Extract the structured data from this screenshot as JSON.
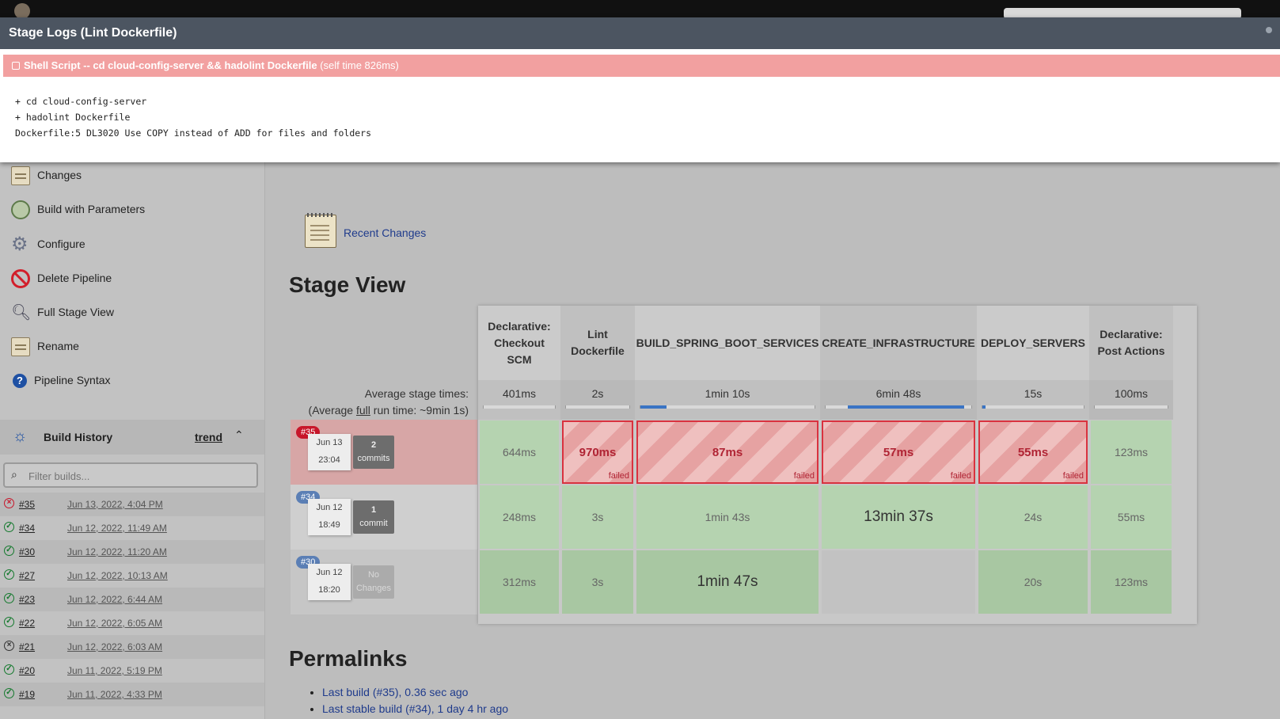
{
  "stage_logs": {
    "title": "Stage Logs (Lint Dockerfile)",
    "step_title": "Shell Script -- cd cloud-config-server && hadolint Dockerfile",
    "step_time": "(self time 826ms)",
    "log_lines": [
      "+ cd cloud-config-server",
      "+ hadolint Dockerfile",
      "Dockerfile:5 DL3020 Use COPY instead of ADD for files and folders"
    ]
  },
  "sidebar": {
    "items": [
      {
        "label": "Changes",
        "icon": "notepad-icon"
      },
      {
        "label": "Build with Parameters",
        "icon": "clock-icon"
      },
      {
        "label": "Configure",
        "icon": "gear-icon"
      },
      {
        "label": "Delete Pipeline",
        "icon": "no-entry-icon"
      },
      {
        "label": "Full Stage View",
        "icon": "magnifier-icon"
      },
      {
        "label": "Rename",
        "icon": "notepad-icon"
      },
      {
        "label": "Pipeline Syntax",
        "icon": "help-icon"
      }
    ]
  },
  "build_history": {
    "title": "Build History",
    "trend_label": "trend",
    "filter_placeholder": "Filter builds...",
    "builds": [
      {
        "num": "#35",
        "date": "Jun 13, 2022, 4:04 PM",
        "status": "failed"
      },
      {
        "num": "#34",
        "date": "Jun 12, 2022, 11:49 AM",
        "status": "success"
      },
      {
        "num": "#30",
        "date": "Jun 12, 2022, 11:20 AM",
        "status": "success"
      },
      {
        "num": "#27",
        "date": "Jun 12, 2022, 10:13 AM",
        "status": "success"
      },
      {
        "num": "#23",
        "date": "Jun 12, 2022, 6:44 AM",
        "status": "success"
      },
      {
        "num": "#22",
        "date": "Jun 12, 2022, 6:05 AM",
        "status": "success"
      },
      {
        "num": "#21",
        "date": "Jun 12, 2022, 6:03 AM",
        "status": "aborted"
      },
      {
        "num": "#20",
        "date": "Jun 11, 2022, 5:19 PM",
        "status": "success"
      },
      {
        "num": "#19",
        "date": "Jun 11, 2022, 4:33 PM",
        "status": "success"
      }
    ]
  },
  "main": {
    "recent_changes": "Recent Changes",
    "stage_view_title": "Stage View",
    "average_stage_times": "Average stage times:",
    "average_full_prefix": "(Average ",
    "average_full_link": "full",
    "average_full_suffix": " run time: ~9min 1s)",
    "permalinks_title": "Permalinks",
    "permalinks": [
      "Last build (#35), 0.36 sec ago",
      "Last stable build (#34), 1 day 4 hr ago"
    ]
  },
  "stage_view": {
    "stages": [
      {
        "name": "Declarative: Checkout SCM",
        "avg": "401ms",
        "avg_fraction": 0.0
      },
      {
        "name": "Lint Dockerfile",
        "avg": "2s",
        "avg_fraction": 0.0
      },
      {
        "name": "BUILD_SPRING_BOOT_SERVICES",
        "avg": "1min 10s",
        "avg_fraction": 0.15
      },
      {
        "name": "CREATE_INFRASTRUCTURE",
        "avg": "6min 48s",
        "avg_fraction": 0.8
      },
      {
        "name": "DEPLOY_SERVERS",
        "avg": "15s",
        "avg_fraction": 0.03
      },
      {
        "name": "Declarative: Post Actions",
        "avg": "100ms",
        "avg_fraction": 0.0
      }
    ],
    "runs": [
      {
        "badge": "#35",
        "date": "Jun 13",
        "time": "23:04",
        "changes_count": "2",
        "changes_label": "commits",
        "status": "failed",
        "cells": [
          {
            "value": "644ms",
            "status": "success"
          },
          {
            "value": "970ms",
            "status": "failed",
            "tag": "failed"
          },
          {
            "value": "87ms",
            "status": "failed",
            "tag": "failed"
          },
          {
            "value": "57ms",
            "status": "failed",
            "tag": "failed"
          },
          {
            "value": "55ms",
            "status": "failed",
            "tag": "failed"
          },
          {
            "value": "123ms",
            "status": "success"
          }
        ]
      },
      {
        "badge": "#34",
        "date": "Jun 12",
        "time": "18:49",
        "changes_count": "1",
        "changes_label": "commit",
        "status": "success",
        "cells": [
          {
            "value": "248ms",
            "status": "success"
          },
          {
            "value": "3s",
            "status": "success"
          },
          {
            "value": "1min 43s",
            "status": "success"
          },
          {
            "value": "13min 37s",
            "status": "success"
          },
          {
            "value": "24s",
            "status": "success"
          },
          {
            "value": "55ms",
            "status": "success"
          }
        ]
      },
      {
        "badge": "#30",
        "date": "Jun 12",
        "time": "18:20",
        "changes_count": "No",
        "changes_label": "Changes",
        "status": "success",
        "cells": [
          {
            "value": "312ms",
            "status": "success"
          },
          {
            "value": "3s",
            "status": "success"
          },
          {
            "value": "1min 47s",
            "status": "success"
          },
          {
            "value": "",
            "status": "empty"
          },
          {
            "value": "20s",
            "status": "success"
          },
          {
            "value": "123ms",
            "status": "success"
          }
        ]
      }
    ]
  },
  "colors": {
    "failed": "#d9323f",
    "success_cell": "#a8c7a2",
    "header_bar": "#4c5561",
    "badge_failed": "#c8162a",
    "badge_ok": "#5b7fb5"
  }
}
